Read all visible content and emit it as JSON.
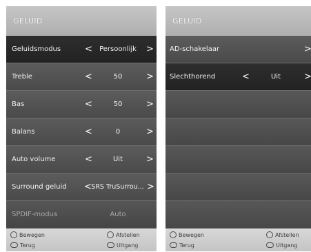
{
  "left_panel": {
    "title": "GELUID",
    "rows": [
      {
        "label": "Geluidsmodus",
        "value": "Persoonlijk",
        "left_arrow": "<",
        "right_arrow": ">"
      },
      {
        "label": "Treble",
        "value": "50",
        "left_arrow": "<",
        "right_arrow": ">"
      },
      {
        "label": "Bas",
        "value": "50",
        "left_arrow": "<",
        "right_arrow": ">"
      },
      {
        "label": "Balans",
        "value": "0",
        "left_arrow": "<",
        "right_arrow": ">"
      },
      {
        "label": "Auto volume",
        "value": "Uit",
        "left_arrow": "<",
        "right_arrow": ">"
      },
      {
        "label": "Surround geluid",
        "value": "SRS TruSurrou...",
        "left_arrow": "<",
        "right_arrow": ">"
      },
      {
        "label": "SPDIF-modus",
        "value": "Auto"
      }
    ],
    "footer": {
      "move": "Bewegen",
      "adjust": "Afstellen",
      "back": "Terug",
      "exit": "Uitgang"
    }
  },
  "right_panel": {
    "title": "GELUID",
    "rows": [
      {
        "label": "AD-schakelaar",
        "right_arrow": ">"
      },
      {
        "label": "Slechthorend",
        "value": "Uit",
        "left_arrow": "<",
        "right_arrow": ">"
      }
    ],
    "footer": {
      "move": "Bewegen",
      "adjust": "Afstellen",
      "back": "Terug",
      "exit": "Uitgang"
    }
  },
  "icons": {
    "move": "dpad-icon",
    "adjust": "dpad-icon",
    "back": "menu-button-icon",
    "exit": "exit-button-icon"
  },
  "colors": {
    "header": "#b8b8b8",
    "row": "#525252",
    "row_selected": "#282828",
    "footer": "#cecece"
  }
}
